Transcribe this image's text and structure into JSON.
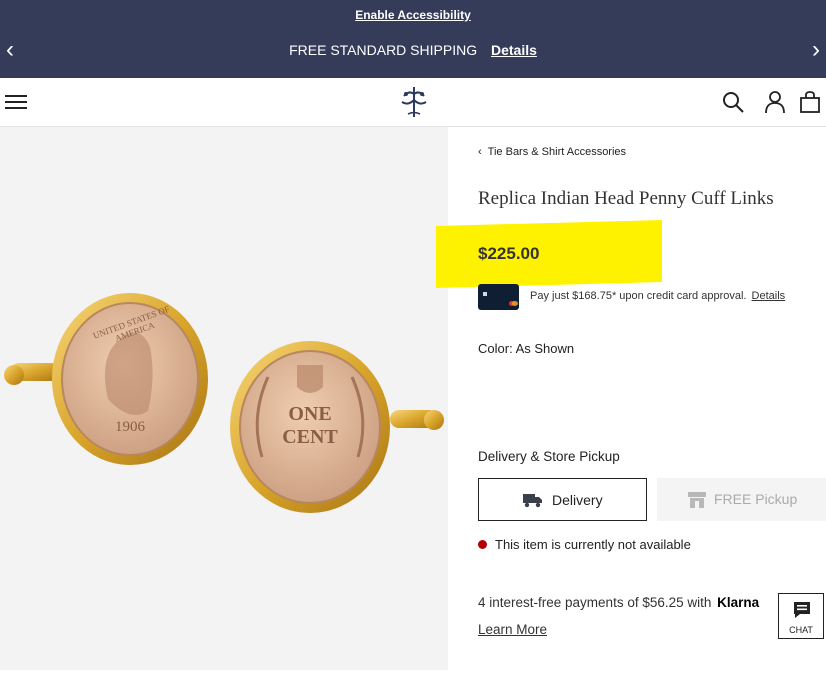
{
  "banner": {
    "accessibility_label": "Enable Accessibility",
    "shipping_text": "FREE STANDARD SHIPPING",
    "details_label": "Details",
    "prev_glyph": "‹",
    "next_glyph": "›",
    "background_color": "#353c5a"
  },
  "header": {
    "icons": [
      "menu-icon",
      "brand-logo",
      "search-icon",
      "account-icon",
      "bag-icon"
    ]
  },
  "product": {
    "breadcrumb": "Tie Bars & Shirt Accessories",
    "title": "Replica Indian Head Penny Cuff Links",
    "price": "$225.00",
    "pay_text": "Pay just $168.75* upon credit card approval.",
    "pay_details": "Details",
    "color_label": "Color: As Shown",
    "delivery_heading": "Delivery & Store Pickup",
    "delivery_button": "Delivery",
    "pickup_button": "FREE Pickup",
    "availability": "This item is currently not available",
    "klarna_text": "4 interest-free payments of $56.25 with",
    "klarna_brand": "Klarna",
    "learn_more": "Learn More",
    "coin_left": {
      "top": "UNITED STATES OF AMERICA",
      "year": "1906"
    },
    "coin_right": {
      "line1": "ONE",
      "line2": "CENT"
    }
  },
  "chat": {
    "label": "CHAT"
  },
  "colors": {
    "highlight": "#fff200",
    "status_dot": "#b30000",
    "gold": "#e0b23b"
  }
}
